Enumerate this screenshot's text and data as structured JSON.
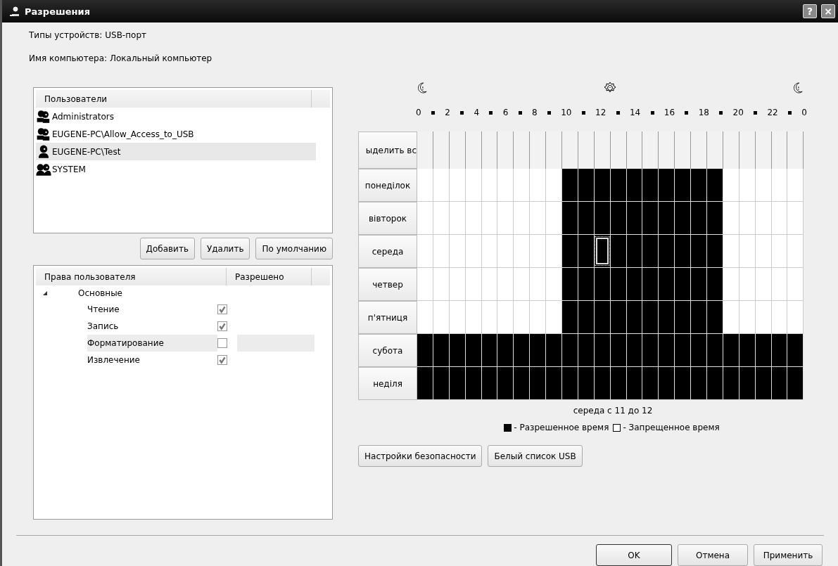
{
  "window": {
    "title": "Разрешения",
    "help_button": "?",
    "close_button": "×"
  },
  "device_type": {
    "label": "Типы устройств:",
    "value": "USB-порт"
  },
  "computer": {
    "label": "Имя компьютера:",
    "value": "Локальный компьютер"
  },
  "users": {
    "column": "Пользователи",
    "items": [
      {
        "name": "Administrators",
        "kind": "group",
        "selected": false
      },
      {
        "name": "EUGENE-PC\\Allow_Access_to_USB",
        "kind": "group",
        "selected": false
      },
      {
        "name": "EUGENE-PC\\Test",
        "kind": "user",
        "selected": true
      },
      {
        "name": "SYSTEM",
        "kind": "system",
        "selected": false
      }
    ]
  },
  "user_buttons": [
    {
      "label": "Добавить"
    },
    {
      "label": "Удалить"
    },
    {
      "label": "По умолчанию"
    }
  ],
  "rights": {
    "columns": [
      "Права пользователя",
      "Разрешено"
    ],
    "groups": [
      {
        "name": "Основные",
        "expanded": true,
        "children": [
          {
            "name": "Чтение",
            "checked": true,
            "selected": false
          },
          {
            "name": "Запись",
            "checked": true,
            "selected": false
          },
          {
            "name": "Форматирование",
            "checked": false,
            "selected": true
          },
          {
            "name": "Извлечение",
            "checked": true,
            "selected": false
          }
        ]
      }
    ]
  },
  "schedule": {
    "hour_labels": [
      "0",
      "2",
      "4",
      "6",
      "8",
      "10",
      "12",
      "14",
      "16",
      "18",
      "20",
      "22",
      "0"
    ],
    "select_all": "ыделить вс",
    "rows": [
      {
        "day": "понеділок",
        "allowed": [
          false,
          false,
          false,
          false,
          false,
          false,
          false,
          false,
          false,
          true,
          true,
          true,
          true,
          true,
          true,
          true,
          true,
          true,
          true,
          false,
          false,
          false,
          false,
          false
        ]
      },
      {
        "day": "вівторок",
        "allowed": [
          false,
          false,
          false,
          false,
          false,
          false,
          false,
          false,
          false,
          true,
          true,
          true,
          true,
          true,
          true,
          true,
          true,
          true,
          true,
          false,
          false,
          false,
          false,
          false
        ]
      },
      {
        "day": "середа",
        "allowed": [
          false,
          false,
          false,
          false,
          false,
          false,
          false,
          false,
          false,
          true,
          true,
          true,
          true,
          true,
          true,
          true,
          true,
          true,
          true,
          false,
          false,
          false,
          false,
          false
        ],
        "focused": [
          false,
          false,
          false,
          false,
          false,
          false,
          false,
          false,
          false,
          false,
          false,
          true,
          false,
          false,
          false,
          false,
          false,
          false,
          false,
          false,
          false,
          false,
          false,
          false
        ]
      },
      {
        "day": "четвер",
        "allowed": [
          false,
          false,
          false,
          false,
          false,
          false,
          false,
          false,
          false,
          true,
          true,
          true,
          true,
          true,
          true,
          true,
          true,
          true,
          true,
          false,
          false,
          false,
          false,
          false
        ]
      },
      {
        "day": "п'ятниця",
        "allowed": [
          false,
          false,
          false,
          false,
          false,
          false,
          false,
          false,
          false,
          true,
          true,
          true,
          true,
          true,
          true,
          true,
          true,
          true,
          true,
          false,
          false,
          false,
          false,
          false
        ]
      },
      {
        "day": "субота",
        "allowed": [
          true,
          true,
          true,
          true,
          true,
          true,
          true,
          true,
          true,
          true,
          true,
          true,
          true,
          true,
          true,
          true,
          true,
          true,
          true,
          true,
          true,
          true,
          true,
          true
        ]
      },
      {
        "day": "неділя",
        "allowed": [
          true,
          true,
          true,
          true,
          true,
          true,
          true,
          true,
          true,
          true,
          true,
          true,
          true,
          true,
          true,
          true,
          true,
          true,
          true,
          true,
          true,
          true,
          true,
          true
        ]
      }
    ],
    "status": "середа с 11 до 12",
    "legend": [
      {
        "kind": "allowed",
        "label": "- Разрешенное время"
      },
      {
        "kind": "denied",
        "label": "- Запрещенное время"
      }
    ]
  },
  "extra_buttons": [
    {
      "label": "Настройки безопасности"
    },
    {
      "label": "Белый список USB"
    }
  ],
  "footer_buttons": [
    {
      "label": "OK",
      "default": true
    },
    {
      "label": "Отмена",
      "default": false
    },
    {
      "label": "Применить",
      "default": false
    }
  ]
}
